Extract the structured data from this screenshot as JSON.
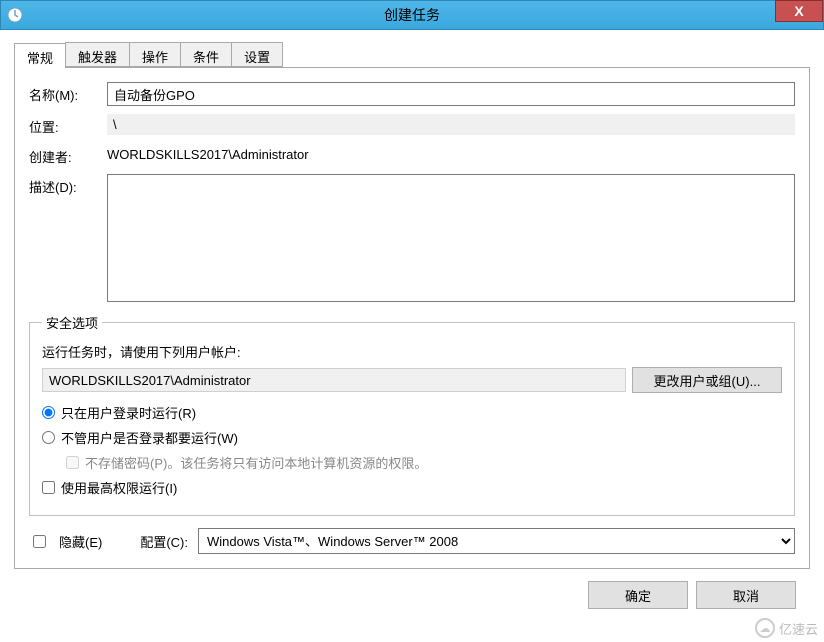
{
  "window": {
    "title": "创建任务",
    "close": "X"
  },
  "tabs": {
    "general": "常规",
    "triggers": "触发器",
    "actions": "操作",
    "conditions": "条件",
    "settings": "设置"
  },
  "fields": {
    "name_label": "名称(M):",
    "name_value": "自动备份GPO",
    "location_label": "位置:",
    "location_value": "\\",
    "creator_label": "创建者:",
    "creator_value": "WORLDSKILLS2017\\Administrator",
    "description_label": "描述(D):",
    "description_value": ""
  },
  "security": {
    "legend": "安全选项",
    "run_as_prompt": "运行任务时，请使用下列用户帐户:",
    "user_account": "WORLDSKILLS2017\\Administrator",
    "change_user_btn": "更改用户或组(U)...",
    "run_logged_on": "只在用户登录时运行(R)",
    "run_whether": "不管用户是否登录都要运行(W)",
    "no_store_pwd": "不存储密码(P)。该任务将只有访问本地计算机资源的权限。",
    "highest_priv": "使用最高权限运行(I)"
  },
  "bottom": {
    "hidden": "隐藏(E)",
    "configure_label": "配置(C):",
    "configure_value": "Windows Vista™、Windows Server™ 2008"
  },
  "buttons": {
    "ok": "确定",
    "cancel": "取消"
  },
  "watermark": "亿速云"
}
